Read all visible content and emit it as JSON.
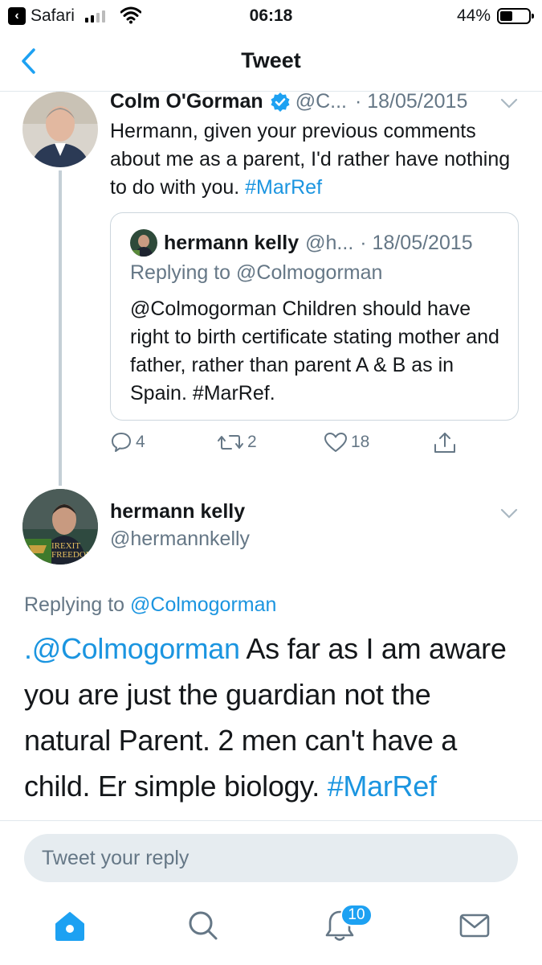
{
  "status_bar": {
    "back_app": "Safari",
    "time": "06:18",
    "battery_percent": "44%",
    "battery_level": 0.44
  },
  "nav": {
    "title": "Tweet"
  },
  "quoted_tweet": {
    "author_name": "Colm O'Gorman",
    "author_handle": "@C...",
    "date": "· 18/05/2015",
    "text": "Hermann, given your previous comments about me as a parent, I'd rather have nothing to do with you. ",
    "hashtag": "#MarRef",
    "embedded": {
      "author_name": "hermann kelly",
      "author_handle": "@h...",
      "date": "· 18/05/2015",
      "replying_to": "Replying to @Colmogorman",
      "text": "@Colmogorman Children should have right to birth certificate stating mother and father, rather than parent A & B as in Spain. #MarRef."
    },
    "actions": {
      "replies": "4",
      "retweets": "2",
      "likes": "18"
    }
  },
  "main_tweet": {
    "author_name": "hermann kelly",
    "author_handle": "@hermannkelly",
    "replying_to_prefix": "Replying to ",
    "replying_to_handle": "@Colmogorman",
    "mention": ".@Colmogorman",
    "text": " As far as I am aware you are just the guardian not the natural Parent.  2 men can't have a child. Er simple biology.  ",
    "hashtag": "#MarRef",
    "avatar_caption": "IREXIT FREEDOM"
  },
  "reply": {
    "placeholder": "Tweet your reply"
  },
  "tab_bar": {
    "notifications_badge": "10"
  },
  "colors": {
    "accent": "#1da1f2",
    "link": "#1b95e0",
    "muted": "#657786"
  }
}
